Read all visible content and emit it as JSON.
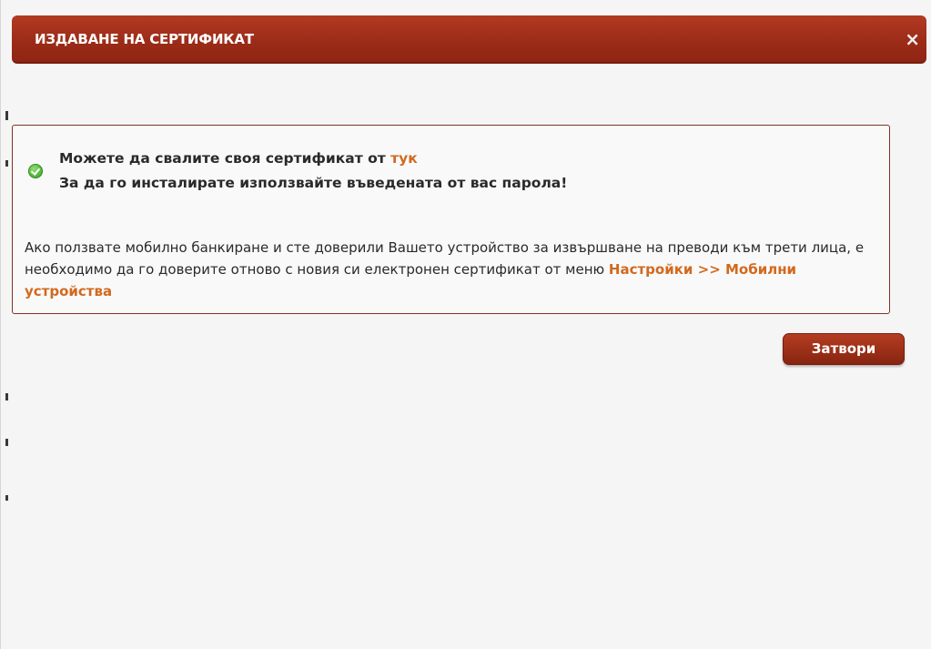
{
  "dialog": {
    "title": "ИЗДАВАНЕ НА СЕРТИФИКАТ",
    "close_icon": "×"
  },
  "message": {
    "icon": "check-circle-icon",
    "line1_text": "Можете да свалите своя сертификат от ",
    "line1_link": "тук",
    "line2_text": "За да го инсталирате използвайте въведената от вас парола!",
    "info_text": "Ако ползвате мобилно банкиране и сте доверили Вашето устройство за извършване на преводи към трети лица, е необходимо да го доверите отново с новия си електронен сертификат от меню ",
    "info_link": "Настройки >> Мобилни устройства"
  },
  "actions": {
    "close_label": "Затвори"
  },
  "colors": {
    "accent": "#9c2c18",
    "link": "#d2691e",
    "success": "#54b53a"
  }
}
